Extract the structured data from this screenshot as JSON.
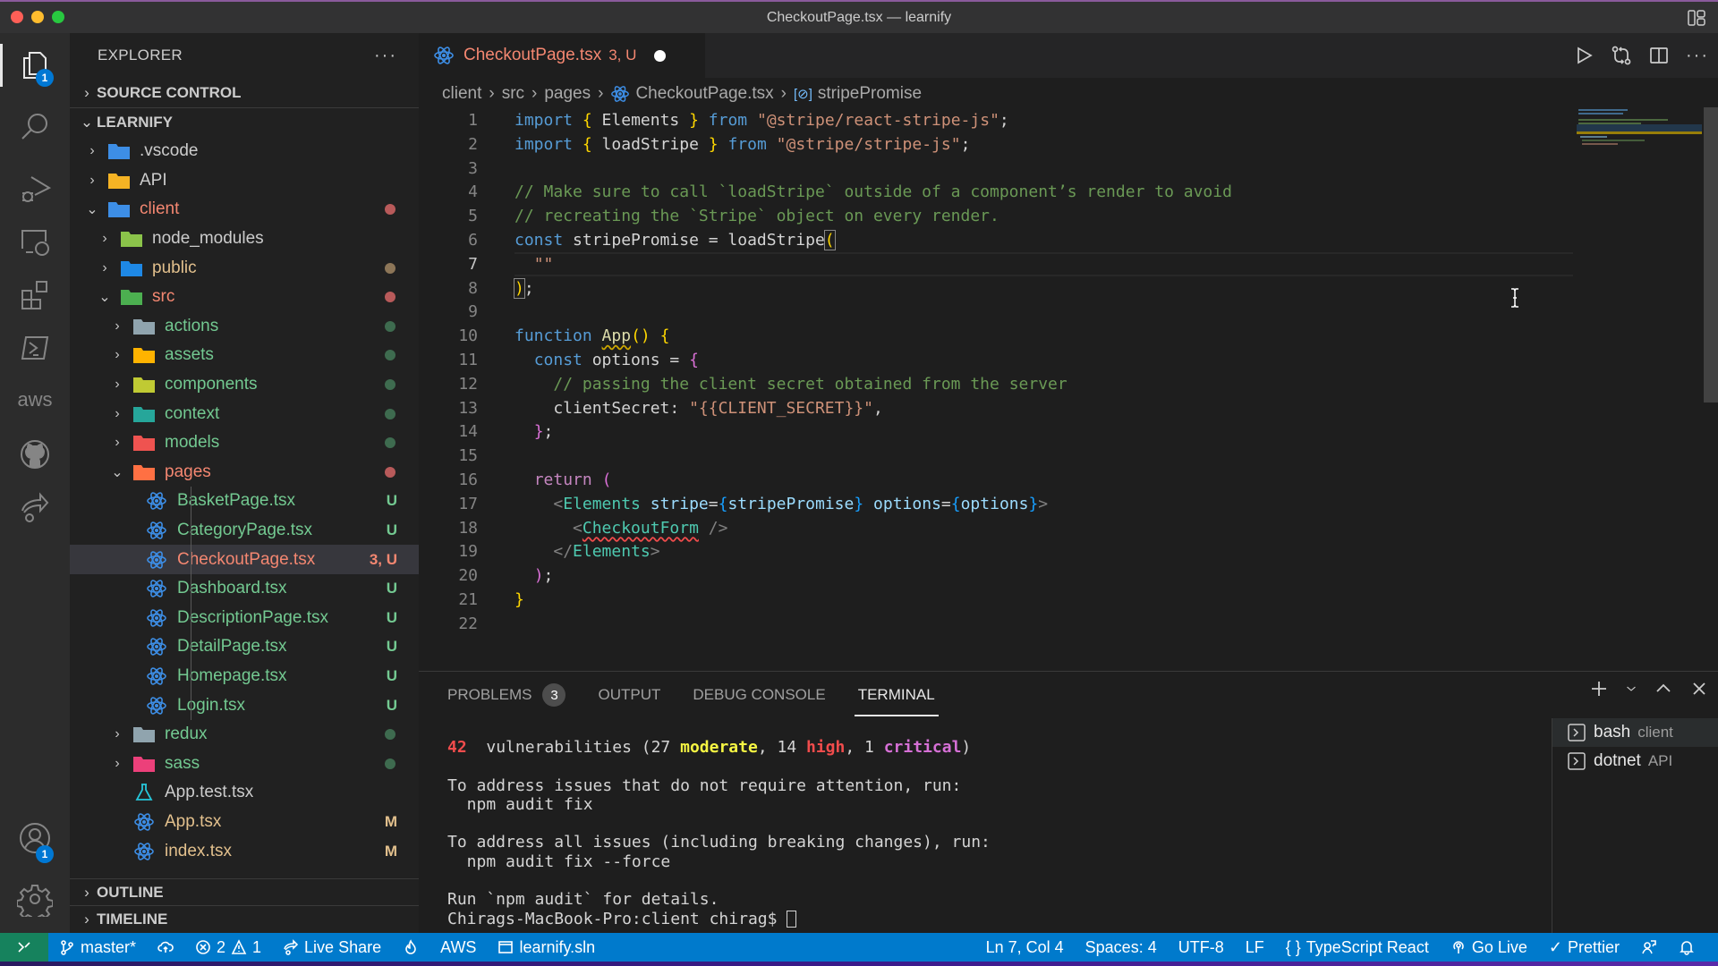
{
  "window": {
    "title": "CheckoutPage.tsx — learnify"
  },
  "activity_bar": {
    "explorer_badge": "1",
    "accounts_badge": "1",
    "items": [
      "explorer",
      "search",
      "run-debug",
      "remote-explorer",
      "extensions",
      "terminal",
      "aws",
      "github",
      "live-share"
    ]
  },
  "sidebar": {
    "title": "EXPLORER",
    "source_control_label": "SOURCE CONTROL",
    "workspace_label": "LEARNIFY",
    "tree": [
      {
        "name": ".vscode",
        "type": "folder",
        "expanded": false,
        "depth": 1,
        "color": "#cccccc",
        "icon": "vscode-folder-icon",
        "icon_color": "#3d8ee6"
      },
      {
        "name": "API",
        "type": "folder",
        "expanded": false,
        "depth": 1,
        "color": "#cccccc",
        "icon": "api-folder-icon",
        "icon_color": "#f5b324"
      },
      {
        "name": "client",
        "type": "folder",
        "expanded": true,
        "depth": 1,
        "color": "#f48771",
        "dot": "#b85a5a",
        "icon": "client-folder-icon",
        "icon_color": "#3d8ee6"
      },
      {
        "name": "node_modules",
        "type": "folder",
        "expanded": false,
        "depth": 2,
        "color": "#cccccc",
        "icon": "node-folder-icon",
        "icon_color": "#8bc34a"
      },
      {
        "name": "public",
        "type": "folder",
        "expanded": false,
        "depth": 2,
        "color": "#e2c08d",
        "dot": "#8d7658",
        "icon": "public-folder-icon",
        "icon_color": "#1e88e5"
      },
      {
        "name": "src",
        "type": "folder",
        "expanded": true,
        "depth": 2,
        "color": "#f48771",
        "dot": "#b85a5a",
        "icon": "src-folder-icon",
        "icon_color": "#4caf50"
      },
      {
        "name": "actions",
        "type": "folder",
        "expanded": false,
        "depth": 3,
        "color": "#73c991",
        "dot": "#3e6b4f",
        "icon": "folder-icon",
        "icon_color": "#90a4ae"
      },
      {
        "name": "assets",
        "type": "folder",
        "expanded": false,
        "depth": 3,
        "color": "#73c991",
        "dot": "#3e6b4f",
        "icon": "assets-folder-icon",
        "icon_color": "#ffb300"
      },
      {
        "name": "components",
        "type": "folder",
        "expanded": false,
        "depth": 3,
        "color": "#73c991",
        "dot": "#3e6b4f",
        "icon": "components-folder-icon",
        "icon_color": "#c0ca33"
      },
      {
        "name": "context",
        "type": "folder",
        "expanded": false,
        "depth": 3,
        "color": "#73c991",
        "dot": "#3e6b4f",
        "icon": "context-folder-icon",
        "icon_color": "#26a69a"
      },
      {
        "name": "models",
        "type": "folder",
        "expanded": false,
        "depth": 3,
        "color": "#73c991",
        "dot": "#3e6b4f",
        "icon": "models-folder-icon",
        "icon_color": "#ef5350"
      },
      {
        "name": "pages",
        "type": "folder",
        "expanded": true,
        "depth": 3,
        "color": "#f48771",
        "dot": "#b85a5a",
        "icon": "pages-folder-icon",
        "icon_color": "#ff7043"
      },
      {
        "name": "BasketPage.tsx",
        "type": "file",
        "depth": 4,
        "color": "#73c991",
        "deco": "U",
        "deco_color": "#73c991",
        "icon": "react-icon"
      },
      {
        "name": "CategoryPage.tsx",
        "type": "file",
        "depth": 4,
        "color": "#73c991",
        "deco": "U",
        "deco_color": "#73c991",
        "icon": "react-icon"
      },
      {
        "name": "CheckoutPage.tsx",
        "type": "file",
        "depth": 4,
        "color": "#f48771",
        "deco": "3, U",
        "deco_color": "#f48771",
        "icon": "react-icon",
        "selected": true
      },
      {
        "name": "Dashboard.tsx",
        "type": "file",
        "depth": 4,
        "color": "#73c991",
        "deco": "U",
        "deco_color": "#73c991",
        "icon": "react-icon"
      },
      {
        "name": "DescriptionPage.tsx",
        "type": "file",
        "depth": 4,
        "color": "#73c991",
        "deco": "U",
        "deco_color": "#73c991",
        "icon": "react-icon"
      },
      {
        "name": "DetailPage.tsx",
        "type": "file",
        "depth": 4,
        "color": "#73c991",
        "deco": "U",
        "deco_color": "#73c991",
        "icon": "react-icon"
      },
      {
        "name": "Homepage.tsx",
        "type": "file",
        "depth": 4,
        "color": "#73c991",
        "deco": "U",
        "deco_color": "#73c991",
        "icon": "react-icon"
      },
      {
        "name": "Login.tsx",
        "type": "file",
        "depth": 4,
        "color": "#73c991",
        "deco": "U",
        "deco_color": "#73c991",
        "icon": "react-icon"
      },
      {
        "name": "redux",
        "type": "folder",
        "expanded": false,
        "depth": 3,
        "color": "#73c991",
        "dot": "#3e6b4f",
        "icon": "folder-icon",
        "icon_color": "#90a4ae"
      },
      {
        "name": "sass",
        "type": "folder",
        "expanded": false,
        "depth": 3,
        "color": "#73c991",
        "dot": "#3e6b4f",
        "icon": "sass-folder-icon",
        "icon_color": "#ec407a"
      },
      {
        "name": "App.test.tsx",
        "type": "file",
        "depth": 3,
        "color": "#cccccc",
        "icon": "test-flask-icon"
      },
      {
        "name": "App.tsx",
        "type": "file",
        "depth": 3,
        "color": "#e2c08d",
        "deco": "M",
        "deco_color": "#e2c08d",
        "icon": "react-icon"
      },
      {
        "name": "index.tsx",
        "type": "file",
        "depth": 3,
        "color": "#e2c08d",
        "deco": "M",
        "deco_color": "#e2c08d",
        "icon": "react-icon"
      }
    ],
    "outline_label": "OUTLINE",
    "timeline_label": "TIMELINE"
  },
  "tabs": [
    {
      "label": "CheckoutPage.tsx",
      "decoration": "3, U",
      "dirty": true,
      "active": true
    }
  ],
  "breadcrumb": [
    "client",
    "src",
    "pages",
    "CheckoutPage.tsx",
    "stripePromise"
  ],
  "editor": {
    "current_line": 7,
    "lines": [
      [
        [
          "kw",
          "import"
        ],
        [
          "plain",
          " "
        ],
        [
          "br1",
          "{"
        ],
        [
          "plain",
          " Elements "
        ],
        [
          "br1",
          "}"
        ],
        [
          "plain",
          " "
        ],
        [
          "kw",
          "from"
        ],
        [
          "plain",
          " "
        ],
        [
          "str",
          "\"@stripe/react-stripe-js\""
        ],
        [
          "plain",
          ";"
        ]
      ],
      [
        [
          "kw",
          "import"
        ],
        [
          "plain",
          " "
        ],
        [
          "br1",
          "{"
        ],
        [
          "plain",
          " loadStripe "
        ],
        [
          "br1",
          "}"
        ],
        [
          "plain",
          " "
        ],
        [
          "kw",
          "from"
        ],
        [
          "plain",
          " "
        ],
        [
          "str",
          "\"@stripe/stripe-js\""
        ],
        [
          "plain",
          ";"
        ]
      ],
      [],
      [
        [
          "cm",
          "// Make sure to call `loadStripe` outside of a component’s render to avoid"
        ]
      ],
      [
        [
          "cm",
          "// recreating the `Stripe` object on every render."
        ]
      ],
      [
        [
          "kw",
          "const"
        ],
        [
          "plain",
          " stripePromise = loadStripe"
        ],
        [
          "br1m",
          "("
        ]
      ],
      [
        [
          "plain",
          "  "
        ],
        [
          "str",
          "\"\""
        ]
      ],
      [
        [
          "br1m",
          ")"
        ],
        [
          "plain",
          ";"
        ]
      ],
      [],
      [
        [
          "kw",
          "function"
        ],
        [
          "plain",
          " "
        ],
        [
          "fnsq",
          "App"
        ],
        [
          "br1",
          "()"
        ],
        [
          "plain",
          " "
        ],
        [
          "br1",
          "{"
        ]
      ],
      [
        [
          "plain",
          "  "
        ],
        [
          "kw",
          "const"
        ],
        [
          "plain",
          " options = "
        ],
        [
          "br2",
          "{"
        ]
      ],
      [
        [
          "plain",
          "    "
        ],
        [
          "cm",
          "// passing the client secret obtained from the server"
        ]
      ],
      [
        [
          "plain",
          "    clientSecret: "
        ],
        [
          "str",
          "\"{{CLIENT_SECRET}}\""
        ],
        [
          "plain",
          ","
        ]
      ],
      [
        [
          "plain",
          "  "
        ],
        [
          "br2",
          "}"
        ],
        [
          "plain",
          ";"
        ]
      ],
      [],
      [
        [
          "plain",
          "  "
        ],
        [
          "kw2",
          "return"
        ],
        [
          "plain",
          " "
        ],
        [
          "br2",
          "("
        ]
      ],
      [
        [
          "plain",
          "    "
        ],
        [
          "punct",
          "<"
        ],
        [
          "tag",
          "Elements"
        ],
        [
          "plain",
          " "
        ],
        [
          "var",
          "stripe"
        ],
        [
          "plain",
          "="
        ],
        [
          "br3",
          "{"
        ],
        [
          "var",
          "stripePromise"
        ],
        [
          "br3",
          "}"
        ],
        [
          "plain",
          " "
        ],
        [
          "var",
          "options"
        ],
        [
          "plain",
          "="
        ],
        [
          "br3",
          "{"
        ],
        [
          "var",
          "options"
        ],
        [
          "br3",
          "}"
        ],
        [
          "punct",
          ">"
        ]
      ],
      [
        [
          "plain",
          "      "
        ],
        [
          "punct",
          "<"
        ],
        [
          "tagsq",
          "CheckoutForm"
        ],
        [
          "plain",
          " "
        ],
        [
          "punct",
          "/>"
        ]
      ],
      [
        [
          "plain",
          "    "
        ],
        [
          "punct",
          "</"
        ],
        [
          "tag",
          "Elements"
        ],
        [
          "punct",
          ">"
        ]
      ],
      [
        [
          "plain",
          "  "
        ],
        [
          "br2",
          ")"
        ],
        [
          "plain",
          ";"
        ]
      ],
      [
        [
          "br1",
          "}"
        ]
      ],
      []
    ]
  },
  "panel": {
    "tabs": [
      {
        "label": "PROBLEMS",
        "badge": "3"
      },
      {
        "label": "OUTPUT"
      },
      {
        "label": "DEBUG CONSOLE"
      },
      {
        "label": "TERMINAL",
        "active": true
      }
    ],
    "terminal_lines": [
      [
        [
          "t-red",
          "42"
        ],
        [
          "",
          "  vulnerabilities (27 "
        ],
        [
          "t-yel",
          "moderate"
        ],
        [
          "",
          ", 14 "
        ],
        [
          "t-red",
          "high"
        ],
        [
          "",
          ", 1 "
        ],
        [
          "t-mag",
          "critical"
        ],
        [
          "",
          ")"
        ]
      ],
      [],
      [
        [
          "",
          "To address issues that do not require attention, run:"
        ]
      ],
      [
        [
          "",
          "  npm audit fix"
        ]
      ],
      [],
      [
        [
          "",
          "To address all issues (including breaking changes), run:"
        ]
      ],
      [
        [
          "",
          "  npm audit fix --force"
        ]
      ],
      [],
      [
        [
          "",
          "Run `npm audit` for details."
        ]
      ],
      [
        [
          "",
          "Chirags-MacBook-Pro:client chirag$ "
        ],
        [
          "cursor",
          ""
        ]
      ]
    ],
    "terminals": [
      {
        "name": "bash",
        "cwd": "client",
        "active": true
      },
      {
        "name": "dotnet",
        "cwd": "API"
      }
    ]
  },
  "statusbar": {
    "branch": "master*",
    "errors": "2",
    "warnings": "1",
    "live_share": "Live Share",
    "aws": "AWS",
    "solution": "learnify.sln",
    "cursor_pos": "Ln 7, Col 4",
    "spaces": "Spaces: 4",
    "encoding": "UTF-8",
    "eol": "LF",
    "language": "TypeScript React",
    "go_live": "Go Live",
    "prettier": "Prettier"
  }
}
